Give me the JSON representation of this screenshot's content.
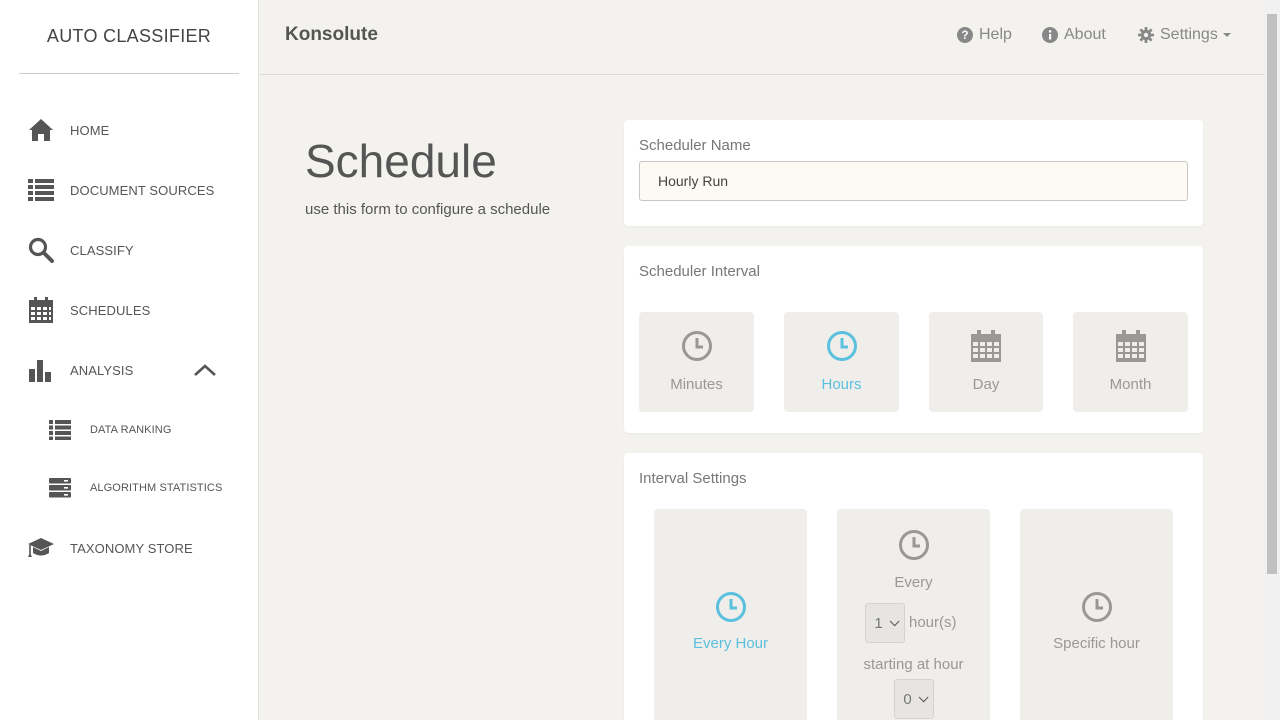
{
  "sidebar": {
    "brand": "AUTO CLASSIFIER",
    "items": [
      {
        "label": "HOME",
        "icon": "home-icon"
      },
      {
        "label": "DOCUMENT SOURCES",
        "icon": "list-icon"
      },
      {
        "label": "CLASSIFY",
        "icon": "search-icon"
      },
      {
        "label": "SCHEDULES",
        "icon": "calendar-icon"
      },
      {
        "label": "ANALYSIS",
        "icon": "bar-chart-icon",
        "expanded": true
      },
      {
        "label": "DATA RANKING",
        "icon": "list-icon"
      },
      {
        "label": "ALGORITHM STATISTICS",
        "icon": "server-icon"
      },
      {
        "label": "TAXONOMY STORE",
        "icon": "graduation-cap-icon"
      }
    ]
  },
  "header": {
    "app_name": "Konsolute",
    "help": "Help",
    "about": "About",
    "settings": "Settings"
  },
  "page": {
    "title": "Schedule",
    "subtitle": "use this form to configure a schedule"
  },
  "scheduler_name": {
    "label": "Scheduler Name",
    "value": "Hourly Run"
  },
  "scheduler_interval": {
    "label": "Scheduler Interval",
    "options": [
      "Minutes",
      "Hours",
      "Day",
      "Month"
    ],
    "selected": "Hours"
  },
  "interval_settings": {
    "label": "Interval Settings",
    "every_hour": "Every Hour",
    "every": "Every",
    "hours_value": "1",
    "hours_unit": "hour(s)",
    "starting_at": "starting at hour",
    "start_value": "0",
    "specific_hour": "Specific hour",
    "selected": "Every Hour"
  },
  "colors": {
    "accent": "#5bc0de",
    "muted_icon": "#9a9895",
    "sidebar_icon": "#555555"
  }
}
